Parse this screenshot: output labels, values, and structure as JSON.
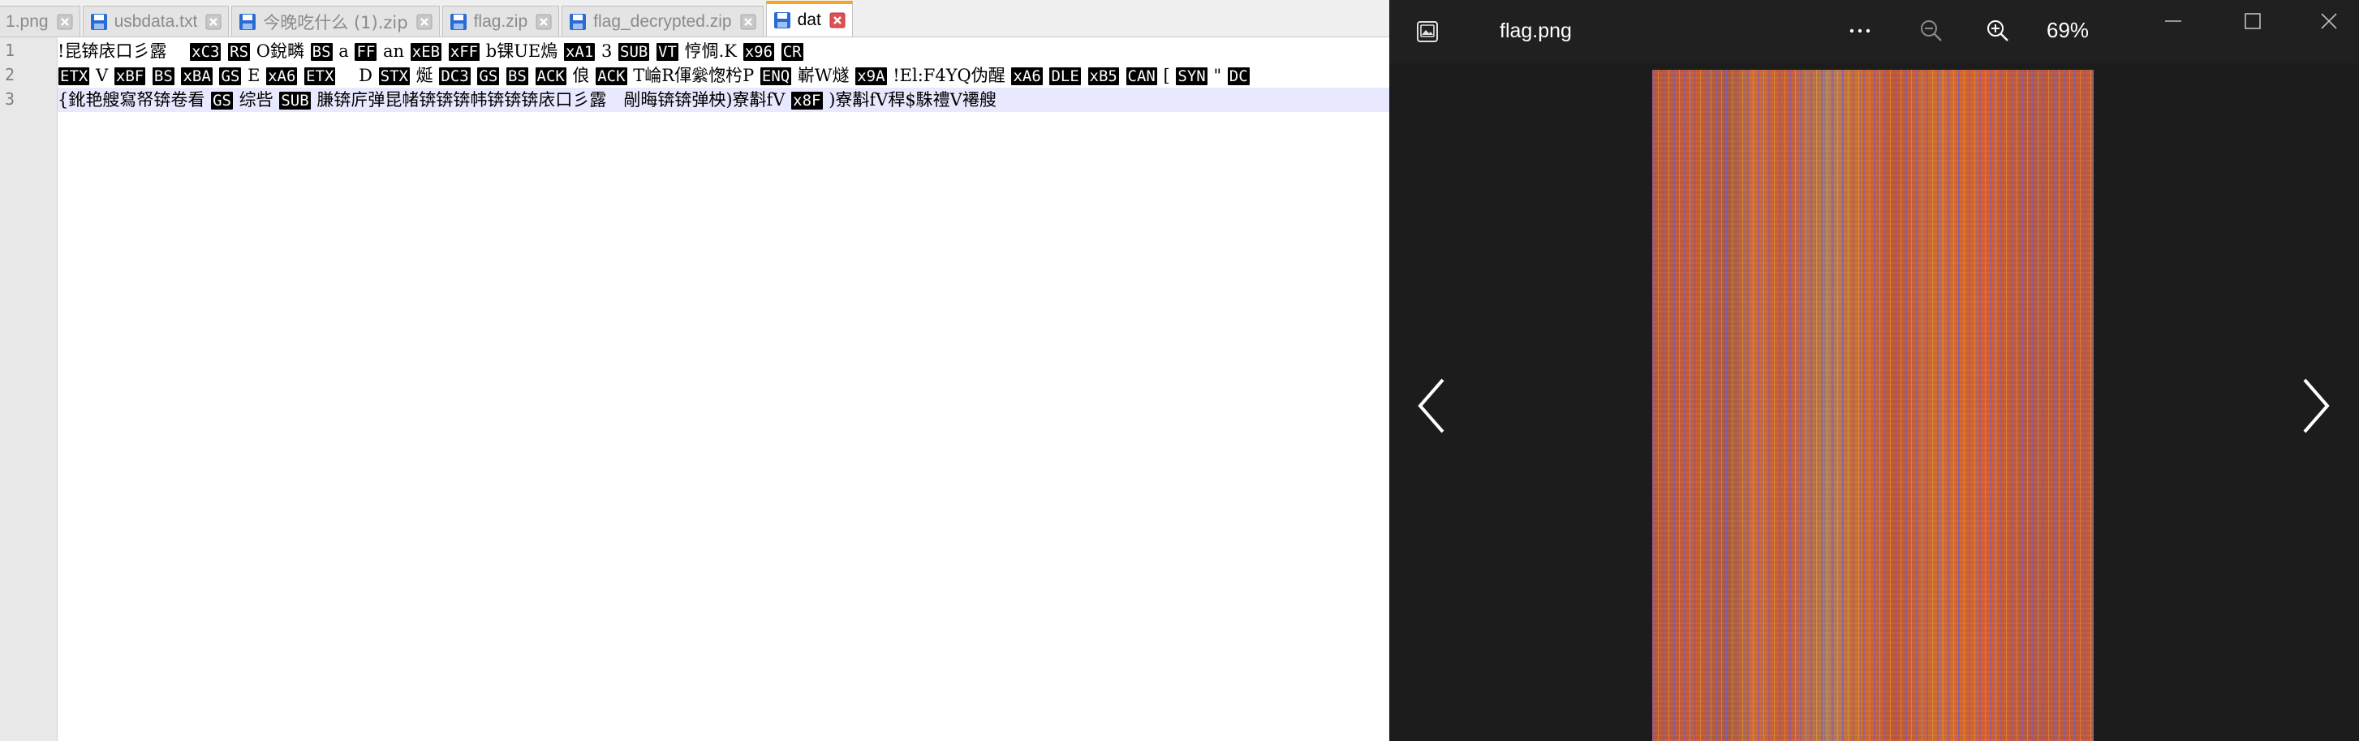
{
  "editor": {
    "tabs": [
      {
        "label": "1.png",
        "active": false
      },
      {
        "label": "usbdata.txt",
        "active": false
      },
      {
        "label": "今晚吃什么 (1).zip",
        "active": false
      },
      {
        "label": "flag.zip",
        "active": false
      },
      {
        "label": "flag_decrypted.zip",
        "active": false
      },
      {
        "label": "dat",
        "active": true
      }
    ],
    "line_numbers": [
      "1",
      "2",
      "3"
    ],
    "lines": {
      "l1": {
        "t1": "!昆锛庡口彡露　",
        "c1": "xC3",
        "c2": "RS",
        "t2": "O銳疄",
        "c3": "BS",
        "t3": "a",
        "c4": "FF",
        "t4": "an",
        "c5": "xEB",
        "c6": "xFF",
        "t5": "b锞UE熓",
        "c7": "xA1",
        "t6": "3",
        "c8": "SUB",
        "c9": "VT",
        "t7": "悙惆.K",
        "c10": "x96",
        "c11": "CR"
      },
      "l2": {
        "c1": "ETX",
        "t1": "V",
        "c2": "xBF",
        "c3": "BS",
        "c4": "xBA",
        "c5": "GS",
        "t2": "E",
        "c6": "xA6",
        "c7": "ETX",
        "t3": "　D",
        "c8": "STX",
        "t4": "烻",
        "c9": "DC3",
        "c10": "GS",
        "c11": "BS",
        "c12": "ACK",
        "t5": "俍",
        "c13": "ACK",
        "t6": "T崘R㑮繠愡枍P",
        "c14": "ENQ",
        "t7": "嶄W燧",
        "c15": "x9A",
        "t8": "!El:F4YQ伪醒",
        "c16": "xA6",
        "c17": "DLE",
        "c18": "xB5",
        "c19": "CAN",
        "t9": "[",
        "c20": "SYN",
        "t10": "\"",
        "c21": "DC"
      },
      "l3": {
        "t1": "{鈋艳艘寫帑锛卷看",
        "c1": "GS",
        "t2": "综呰",
        "c2": "SUB",
        "t3": "膁锛庍弹昆帾锛锛锛帏锛锛锛庡口彡露　剮晦锛锛弹柍)寮斠fV",
        "c3": "x8F",
        "t4": ")寮斠fV稈$駯禮V褼艘"
      }
    }
  },
  "viewer": {
    "filename": "flag.png",
    "zoom_level": "69%",
    "icons": {
      "app": "photo-app-icon",
      "more": "more-icon",
      "zoom_out": "zoom-out-icon",
      "zoom_in": "zoom-in-icon",
      "minimize": "minimize-icon",
      "maximize": "maximize-icon",
      "close": "close-icon",
      "prev": "chevron-left-icon",
      "next": "chevron-right-icon"
    }
  },
  "colors": {
    "editor_bg": "#ffffff",
    "tab_active_accent": "#f5a623",
    "save_icon_blue": "#2b6cd4",
    "tab_close_red": "#d9534f",
    "control_char_bg": "#000000",
    "current_line_bg": "#e8e8ff",
    "viewer_bg": "#1c1c1c"
  }
}
